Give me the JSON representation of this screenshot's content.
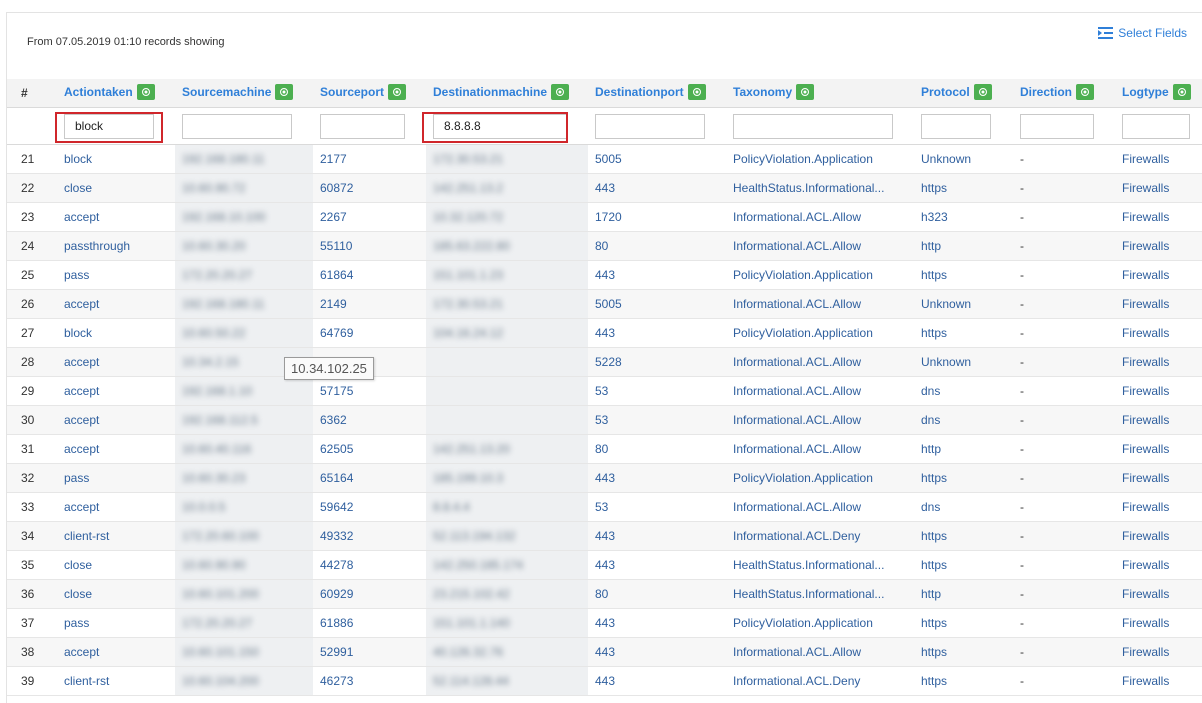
{
  "header": {
    "records_info": "From 07.05.2019 01:10 records showing",
    "select_fields_label": "Select Fields",
    "select_fields_icon": "list-indent-icon"
  },
  "columns": [
    {
      "key": "num",
      "label": "#"
    },
    {
      "key": "action",
      "label": "Actiontaken"
    },
    {
      "key": "srcmachine",
      "label": "Sourcemachine"
    },
    {
      "key": "srcport",
      "label": "Sourceport"
    },
    {
      "key": "dstmachine",
      "label": "Destinationmachine"
    },
    {
      "key": "dstport",
      "label": "Destinationport"
    },
    {
      "key": "taxonomy",
      "label": "Taxonomy"
    },
    {
      "key": "protocol",
      "label": "Protocol"
    },
    {
      "key": "direction",
      "label": "Direction"
    },
    {
      "key": "logtype",
      "label": "Logtype"
    }
  ],
  "filters": {
    "action": "block",
    "srcmachine": "",
    "srcport": "",
    "dstmachine": "8.8.8.8",
    "dstport": "",
    "taxonomy": "",
    "protocol": "",
    "direction": "",
    "logtype": ""
  },
  "tooltip": "10.34.102.25",
  "colors": {
    "accent": "#2f7fd8",
    "eye_button": "#4caf50",
    "highlight": "#d0262b"
  },
  "rows": [
    {
      "num": "21",
      "action": "block",
      "src": "192.168.180.11",
      "srcport": "2177",
      "dst": "172.30.53.21",
      "dstport": "5005",
      "taxonomy": "PolicyViolation.Application",
      "protocol": "Unknown",
      "direction": "-",
      "logtype": "Firewalls"
    },
    {
      "num": "22",
      "action": "close",
      "src": "10.60.90.72",
      "srcport": "60872",
      "dst": "142.251.13.2",
      "dstport": "443",
      "taxonomy": "HealthStatus.Informational...",
      "protocol": "https",
      "direction": "-",
      "logtype": "Firewalls"
    },
    {
      "num": "23",
      "action": "accept",
      "src": "192.168.10.100",
      "srcport": "2267",
      "dst": "10.32.120.72",
      "dstport": "1720",
      "taxonomy": "Informational.ACL.Allow",
      "protocol": "h323",
      "direction": "-",
      "logtype": "Firewalls"
    },
    {
      "num": "24",
      "action": "passthrough",
      "src": "10.60.30.20",
      "srcport": "55110",
      "dst": "185.63.222.80",
      "dstport": "80",
      "taxonomy": "Informational.ACL.Allow",
      "protocol": "http",
      "direction": "-",
      "logtype": "Firewalls"
    },
    {
      "num": "25",
      "action": "pass",
      "src": "172.20.20.27",
      "srcport": "61864",
      "dst": "151.101.1.23",
      "dstport": "443",
      "taxonomy": "PolicyViolation.Application",
      "protocol": "https",
      "direction": "-",
      "logtype": "Firewalls"
    },
    {
      "num": "26",
      "action": "accept",
      "src": "192.168.180.11",
      "srcport": "2149",
      "dst": "172.30.53.21",
      "dstport": "5005",
      "taxonomy": "Informational.ACL.Allow",
      "protocol": "Unknown",
      "direction": "-",
      "logtype": "Firewalls"
    },
    {
      "num": "27",
      "action": "block",
      "src": "10.60.50.22",
      "srcport": "64769",
      "dst": "104.16.24.12",
      "dstport": "443",
      "taxonomy": "PolicyViolation.Application",
      "protocol": "https",
      "direction": "-",
      "logtype": "Firewalls"
    },
    {
      "num": "28",
      "action": "accept",
      "src": "10.34.2.15",
      "srcport": "",
      "dst": "",
      "dstport": "5228",
      "taxonomy": "Informational.ACL.Allow",
      "protocol": "Unknown",
      "direction": "-",
      "logtype": "Firewalls"
    },
    {
      "num": "29",
      "action": "accept",
      "src": "192.168.1.10",
      "srcport": "57175",
      "dst": "",
      "dstport": "53",
      "taxonomy": "Informational.ACL.Allow",
      "protocol": "dns",
      "direction": "-",
      "logtype": "Firewalls"
    },
    {
      "num": "30",
      "action": "accept",
      "src": "192.168.112.5",
      "srcport": "6362",
      "dst": "",
      "dstport": "53",
      "taxonomy": "Informational.ACL.Allow",
      "protocol": "dns",
      "direction": "-",
      "logtype": "Firewalls"
    },
    {
      "num": "31",
      "action": "accept",
      "src": "10.60.40.116",
      "srcport": "62505",
      "dst": "142.251.13.20",
      "dstport": "80",
      "taxonomy": "Informational.ACL.Allow",
      "protocol": "http",
      "direction": "-",
      "logtype": "Firewalls"
    },
    {
      "num": "32",
      "action": "pass",
      "src": "10.60.30.23",
      "srcport": "65164",
      "dst": "185.199.10.3",
      "dstport": "443",
      "taxonomy": "PolicyViolation.Application",
      "protocol": "https",
      "direction": "-",
      "logtype": "Firewalls"
    },
    {
      "num": "33",
      "action": "accept",
      "src": "10.0.0.5",
      "srcport": "59642",
      "dst": "8.8.4.4",
      "dstport": "53",
      "taxonomy": "Informational.ACL.Allow",
      "protocol": "dns",
      "direction": "-",
      "logtype": "Firewalls"
    },
    {
      "num": "34",
      "action": "client-rst",
      "src": "172.20.60.100",
      "srcport": "49332",
      "dst": "52.113.194.132",
      "dstport": "443",
      "taxonomy": "Informational.ACL.Deny",
      "protocol": "https",
      "direction": "-",
      "logtype": "Firewalls"
    },
    {
      "num": "35",
      "action": "close",
      "src": "10.60.90.90",
      "srcport": "44278",
      "dst": "142.250.185.174",
      "dstport": "443",
      "taxonomy": "HealthStatus.Informational...",
      "protocol": "https",
      "direction": "-",
      "logtype": "Firewalls"
    },
    {
      "num": "36",
      "action": "close",
      "src": "10.60.101.200",
      "srcport": "60929",
      "dst": "23.215.102.42",
      "dstport": "80",
      "taxonomy": "HealthStatus.Informational...",
      "protocol": "http",
      "direction": "-",
      "logtype": "Firewalls"
    },
    {
      "num": "37",
      "action": "pass",
      "src": "172.20.20.27",
      "srcport": "61886",
      "dst": "151.101.1.140",
      "dstport": "443",
      "taxonomy": "PolicyViolation.Application",
      "protocol": "https",
      "direction": "-",
      "logtype": "Firewalls"
    },
    {
      "num": "38",
      "action": "accept",
      "src": "10.60.101.150",
      "srcport": "52991",
      "dst": "40.126.32.76",
      "dstport": "443",
      "taxonomy": "Informational.ACL.Allow",
      "protocol": "https",
      "direction": "-",
      "logtype": "Firewalls"
    },
    {
      "num": "39",
      "action": "client-rst",
      "src": "10.60.104.200",
      "srcport": "46273",
      "dst": "52.114.128.44",
      "dstport": "443",
      "taxonomy": "Informational.ACL.Deny",
      "protocol": "https",
      "direction": "-",
      "logtype": "Firewalls"
    }
  ]
}
